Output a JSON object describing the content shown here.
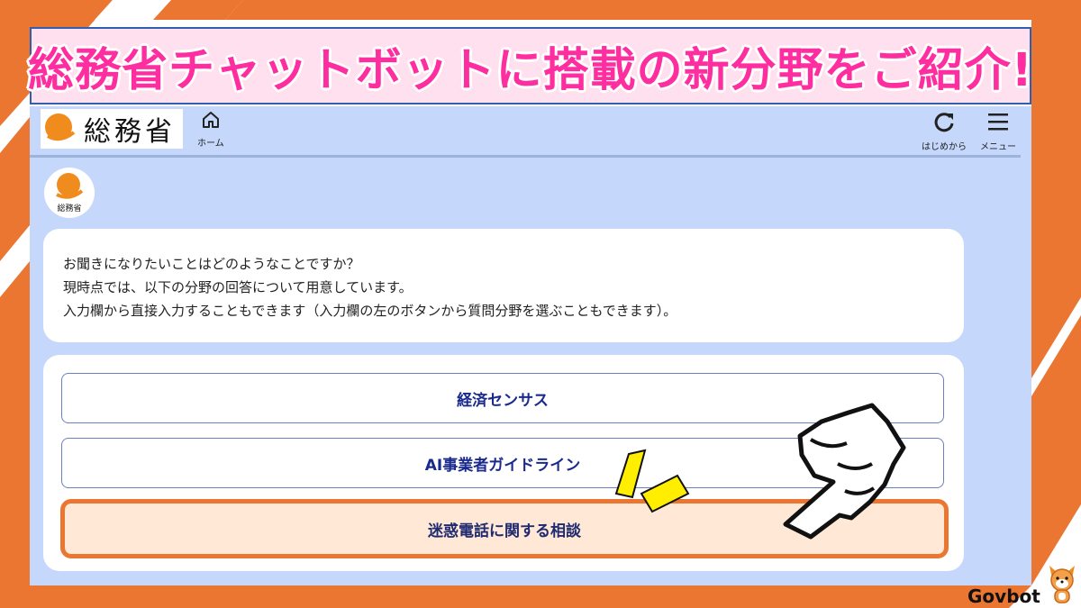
{
  "banner": {
    "title": "総務省チャットボットに搭載の新分野をご紹介!"
  },
  "header": {
    "logo_text": "総務省",
    "home_label": "ホーム",
    "restart_label": "はじめから",
    "menu_label": "メニュー"
  },
  "bot": {
    "avatar_label": "総務省"
  },
  "message": {
    "lines": [
      "お聞きになりたいことはどのようなことですか？",
      "現時点では、以下の分野の回答について用意しています。",
      "入力欄から直接入力することもできます（入力欄の左のボタンから質問分野を選ぶこともできます）。"
    ]
  },
  "options": [
    {
      "label": "経済センサス"
    },
    {
      "label": "AI事業者ガイドライン"
    },
    {
      "label": "迷惑電話に関する相談",
      "highlighted": true
    }
  ],
  "branding": {
    "name": "Govbot"
  },
  "colors": {
    "frame_orange": "#ea7632",
    "screen_blue": "#c5d7fb",
    "title_pink": "#ff2ea0",
    "option_text": "#1a2a8c",
    "highlight_fill": "#ffe8d6"
  }
}
